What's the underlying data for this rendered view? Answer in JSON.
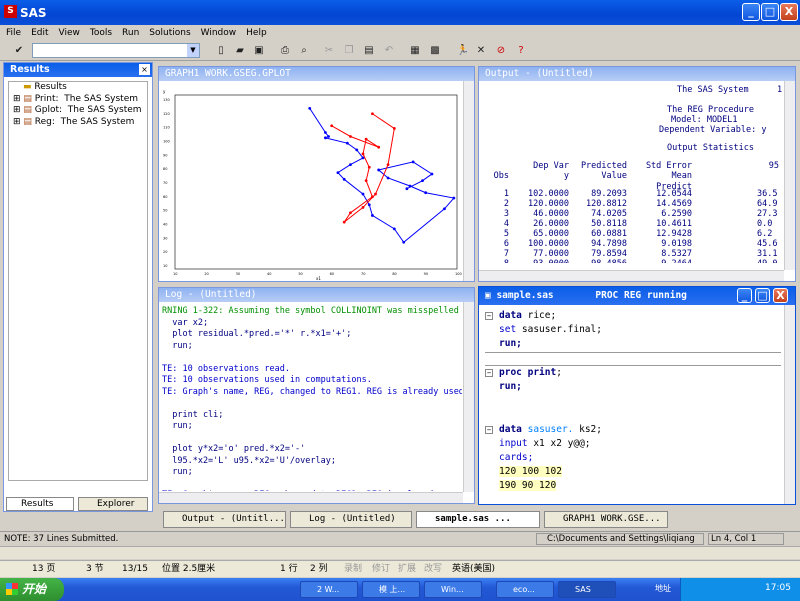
{
  "window": {
    "title": "SAS",
    "min": "_",
    "max": "□",
    "close": "X"
  },
  "menu": [
    "File",
    "Edit",
    "View",
    "Tools",
    "Run",
    "Solutions",
    "Window",
    "Help"
  ],
  "results": {
    "title": "Results",
    "root": "Results",
    "items": [
      "Print:  The SAS System",
      "Gplot:  The SAS System",
      "Reg:  The SAS System"
    ],
    "tabs": [
      "Results",
      "Explorer"
    ]
  },
  "graph": {
    "title": "GRAPH1  WORK.GSEG.GPLOT",
    "ylabel": "y",
    "xlabel": "x1",
    "y_ticks": [
      "130",
      "120",
      "110",
      "100",
      "90",
      "80",
      "70",
      "60",
      "50",
      "40",
      "30",
      "20",
      "10"
    ],
    "x_ticks": [
      "10",
      "20",
      "30",
      "40",
      "50",
      "60",
      "70",
      "80",
      "90",
      "100"
    ]
  },
  "chart_data": {
    "type": "line",
    "series": [
      {
        "color": "#0000ff",
        "points": [
          [
            53,
            130
          ],
          [
            58,
            112
          ],
          [
            59,
            109
          ],
          [
            58,
            108
          ],
          [
            65,
            104
          ],
          [
            68,
            99
          ],
          [
            70,
            93
          ],
          [
            66,
            88
          ],
          [
            62,
            82
          ],
          [
            64,
            77
          ],
          [
            70,
            66
          ],
          [
            72,
            58
          ],
          [
            73,
            50
          ],
          [
            80,
            40
          ],
          [
            83,
            30
          ],
          [
            96,
            55
          ],
          [
            99,
            63
          ],
          [
            90,
            67
          ],
          [
            85,
            72
          ],
          [
            78,
            78
          ],
          [
            75,
            84
          ],
          [
            86,
            90
          ],
          [
            92,
            81
          ],
          [
            89,
            76
          ],
          [
            84,
            70
          ]
        ]
      },
      {
        "color": "#ff0000",
        "points": [
          [
            60,
            117
          ],
          [
            66,
            109
          ],
          [
            75,
            101
          ],
          [
            71,
            107
          ],
          [
            70,
            96
          ],
          [
            72,
            86
          ],
          [
            71,
            76
          ],
          [
            73,
            64
          ],
          [
            66,
            52
          ],
          [
            64,
            45
          ],
          [
            70,
            56
          ],
          [
            74,
            66
          ],
          [
            78,
            88
          ],
          [
            80,
            115
          ],
          [
            73,
            126
          ]
        ]
      }
    ]
  },
  "output": {
    "title": "Output - (Untitled)",
    "system": "The SAS System",
    "page": "1",
    "proc": "The REG Procedure",
    "model": "Model: MODEL1",
    "dep": "Dependent Variable: y",
    "section": "Output Statistics",
    "headers": [
      [
        "",
        "Obs"
      ],
      [
        "Dep Var",
        "y"
      ],
      [
        "Predicted",
        "Value"
      ],
      [
        "Std Error",
        "Mean Predict"
      ],
      [
        "95",
        ""
      ]
    ],
    "rows": [
      [
        "1",
        "102.0000",
        "89.2093",
        "12.0544",
        "36.5"
      ],
      [
        "2",
        "120.0000",
        "120.8812",
        "14.4569",
        "64.9"
      ],
      [
        "3",
        "46.0000",
        "74.0205",
        "6.2590",
        "27.3"
      ],
      [
        "4",
        "26.0000",
        "50.8118",
        "10.4611",
        "0.0"
      ],
      [
        "5",
        "65.0000",
        "60.0881",
        "12.9428",
        "6.2"
      ],
      [
        "6",
        "100.0000",
        "94.7898",
        "9.0198",
        "45.6"
      ],
      [
        "7",
        "77.0000",
        "79.8594",
        "8.5327",
        "31.1"
      ],
      [
        "8",
        "93.0000",
        "98.4856",
        "9.2464",
        "49.0"
      ]
    ]
  },
  "log": {
    "title": "Log - (Untitled)",
    "lines": [
      {
        "c": "green",
        "t": "RNING 1-322: Assuming the symbol COLLINOINT was misspelled as co"
      },
      {
        "c": "navy",
        "t": "  var x2;"
      },
      {
        "c": "navy",
        "t": "  plot residual.*pred.='*' r.*x1='+';"
      },
      {
        "c": "navy",
        "t": "  run;"
      },
      {
        "c": "navy",
        "t": ""
      },
      {
        "c": "blue",
        "t": "TE: 10 observations read."
      },
      {
        "c": "blue",
        "t": "TE: 10 observations used in computations."
      },
      {
        "c": "blue",
        "t": "TE: Graph's name, REG, changed to REG1. REG is already used or n"
      },
      {
        "c": "navy",
        "t": ""
      },
      {
        "c": "navy",
        "t": "  print cli;"
      },
      {
        "c": "navy",
        "t": "  run;"
      },
      {
        "c": "navy",
        "t": ""
      },
      {
        "c": "navy",
        "t": "  plot y*x2='o' pred.*x2='-'"
      },
      {
        "c": "navy",
        "t": "  l95.*x2='L' u95.*x2='U'/overlay;"
      },
      {
        "c": "navy",
        "t": "  run;"
      },
      {
        "c": "navy",
        "t": ""
      },
      {
        "c": "blue",
        "t": "TE: Graph's name, REG, changed to REG2. REG is already used or n"
      }
    ]
  },
  "editor": {
    "title": "sample.sas",
    "status": "PROC REG running",
    "lines": [
      [
        "data",
        " rice;"
      ],
      [
        "set",
        " sasuser.final;"
      ],
      [
        "run;",
        ""
      ],
      [
        "",
        ""
      ],
      [
        "proc print",
        ";"
      ],
      [
        "run;",
        ""
      ],
      [
        "",
        ""
      ],
      [
        "",
        ""
      ],
      [
        "data",
        " sasuser. ks2;"
      ],
      [
        "input",
        " x1 x2 y@@;"
      ],
      [
        "cards;",
        ""
      ],
      [
        "120 100 102",
        ""
      ],
      [
        "190 90 120",
        ""
      ]
    ]
  },
  "taskbar": [
    "Output - (Untitl...",
    "Log - (Untitled)",
    "sample.sas   ...",
    "GRAPH1  WORK.GSE..."
  ],
  "status": {
    "note": "NOTE: 37 Lines Submitted.",
    "path": "C:\\Documents and Settings\\liqiang",
    "pos": "Ln 4, Col 1"
  },
  "word_status": [
    "13 页",
    "3 节",
    "13/15",
    "位置 2.5厘米",
    "1 行",
    "2 列",
    "录制",
    "修订",
    "扩展",
    "改写",
    "英语(美国)"
  ],
  "wintaskbar": {
    "start": "开始",
    "items": [
      "2 W...",
      "模 上...",
      "Win...",
      "eco...",
      "SAS"
    ],
    "clock": "17:05",
    "addr": "地址"
  }
}
